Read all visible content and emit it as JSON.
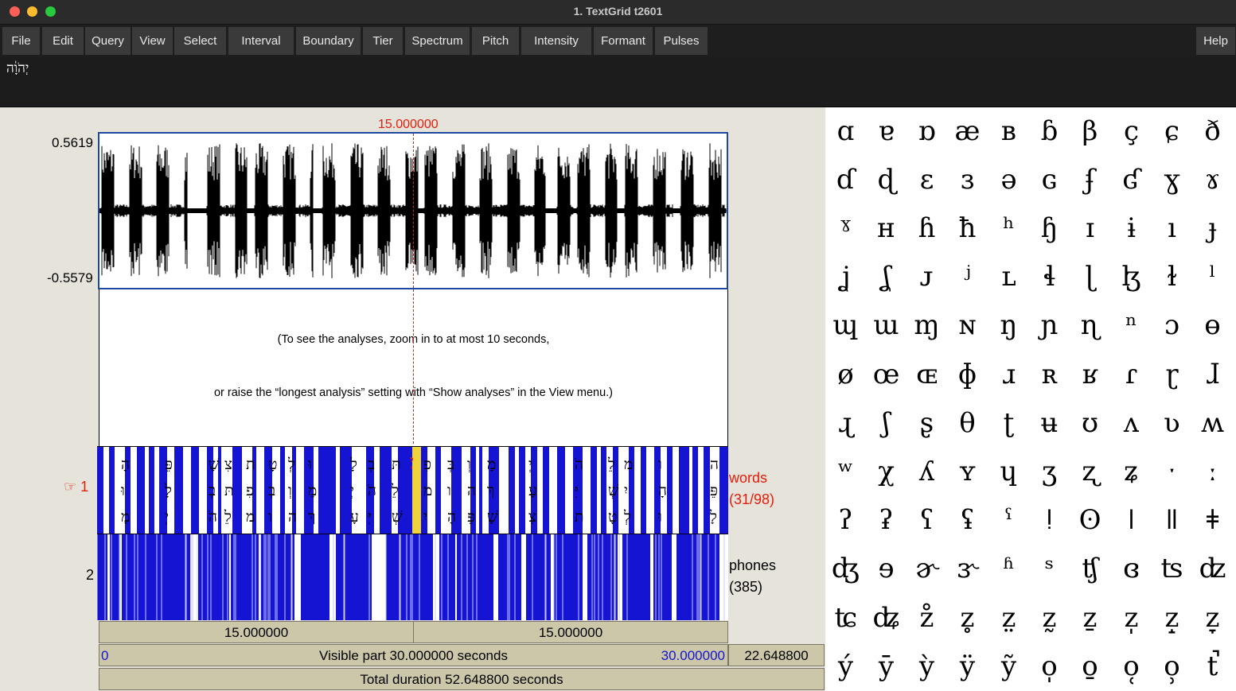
{
  "window": {
    "title": "1. TextGrid t2601"
  },
  "menus": [
    "File",
    "Edit",
    "Query",
    "View",
    "Select",
    "Interval",
    "Boundary",
    "Tier",
    "Spectrum",
    "Pitch",
    "Intensity",
    "Formant",
    "Pulses"
  ],
  "help_label": "Help",
  "text_field": {
    "value": "יְהֹוָ֔ה"
  },
  "cursor_time": "15.000000",
  "waveform": {
    "y_max": "0.5619",
    "y_min": "-0.5579"
  },
  "analysis_message": {
    "line1": "(To see the analyses, zoom in to at most 10 seconds,",
    "line2": "or raise the “longest analysis” setting with “Show analyses” in the View menu.)"
  },
  "tiers": [
    {
      "number": "1",
      "marker": "☞",
      "name": "words",
      "count": "(31/98)",
      "selected": true,
      "color": "#e51c0c"
    },
    {
      "number": "2",
      "marker": "",
      "name": "phones",
      "count": "(385)",
      "selected": false,
      "color": "#000000"
    }
  ],
  "time_bars": {
    "left_segment": "15.000000",
    "right_segment": "15.000000",
    "visible_start": "0",
    "visible_text": "Visible part 30.000000 seconds",
    "visible_end": "30.000000",
    "remaining": "22.648800",
    "total_text": "Total duration 52.648800 seconds"
  },
  "colors": {
    "accent_red": "#e51c0c",
    "tier_blue": "#1414d2",
    "visible_blue": "#1414d2"
  },
  "ipa_symbols": [
    "ɑ",
    "ɐ",
    "ɒ",
    "æ",
    "ʙ",
    "ɓ",
    "β",
    "ç",
    "ɕ",
    "ð",
    "ɗ",
    "ɖ",
    "ɛ",
    "ɜ",
    "ə",
    "ɢ",
    "ʄ",
    "ʛ",
    "ɣ",
    "ɤ",
    "ˠ",
    "ʜ",
    "ɦ",
    "ħ",
    "ʰ",
    "ɧ",
    "ɪ",
    "ɨ",
    "ı",
    "ɟ",
    "ʝ",
    "ʆ",
    "ᴊ",
    "ʲ",
    "ʟ",
    "ɬ",
    "ɭ",
    "ɮ",
    "ɫ",
    "ˡ",
    "ɰ",
    "ɯ",
    "ɱ",
    "ɴ",
    "ŋ",
    "ɲ",
    "ɳ",
    "ⁿ",
    "ɔ",
    "ɵ",
    "ø",
    "œ",
    "ɶ",
    "ɸ",
    "ɹ",
    "ʀ",
    "ʁ",
    "ɾ",
    "ɽ",
    "ɺ",
    "ɻ",
    "ʃ",
    "ʂ",
    "θ",
    "ʈ",
    "ʉ",
    "ʊ",
    "ʌ",
    "ʋ",
    "ʍ",
    "ʷ",
    "χ",
    "ʎ",
    "ʏ",
    "ɥ",
    "ʒ",
    "ʐ",
    "ʑ",
    "ˑ",
    "ː",
    "ʔ",
    "ʡ",
    "ʕ",
    "ʢ",
    "ˤ",
    "ǃ",
    "ʘ",
    "ǀ",
    "ǁ",
    "ǂ",
    "ʤ",
    "ɘ",
    "ɚ",
    "ɝ",
    "ʱ",
    "ˢ",
    "ʧ",
    "ɞ",
    "ʦ",
    "ʣ",
    "ʨ",
    "ʥ",
    "z̊",
    "z̥",
    "z̤",
    "z̰",
    "ẕ",
    "z̩",
    "z̝",
    "z̞",
    "ý",
    "ȳ",
    "ỳ",
    "ÿ",
    "ỹ",
    "o̩",
    "o̱",
    "o̜",
    "o̹",
    "t̚"
  ],
  "words_glyphs": [
    "הָ",
    "פֵּ",
    "שָׁ",
    "צִ",
    "ת",
    "טָ",
    "לְ",
    "וּ",
    "לָ",
    "בְ",
    "תּ",
    "פִ",
    "בְּ",
    "וְ",
    "מָ",
    "יְ",
    "הֹ",
    "לֵ",
    "מ",
    "ו",
    "ה",
    "ךְ",
    "עָ",
    "יִּ",
    "שְׁ",
    "יִ"
  ]
}
